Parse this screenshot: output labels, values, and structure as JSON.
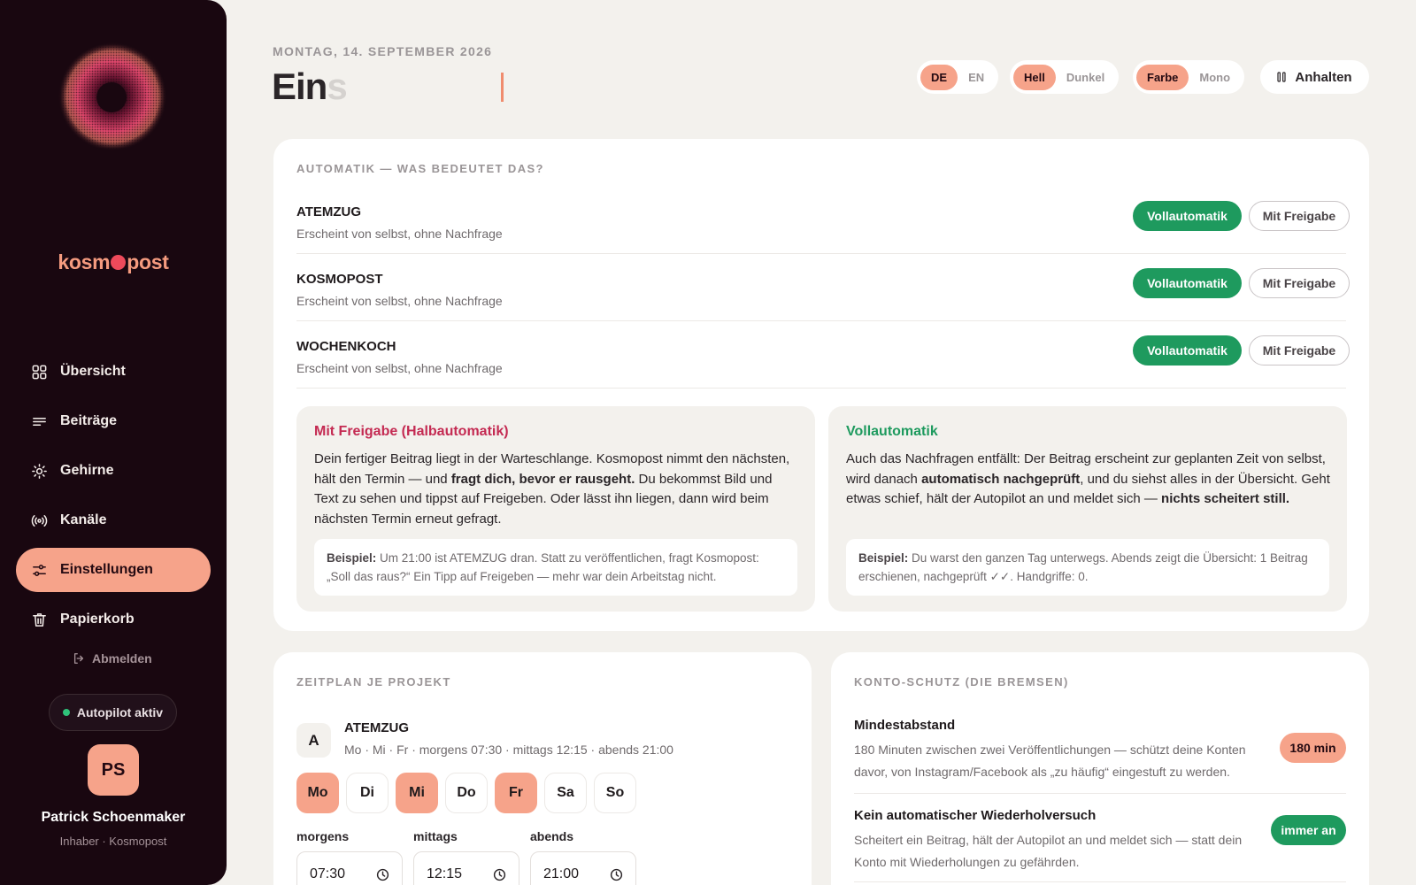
{
  "sidebar": {
    "brand_left": "kosm",
    "brand_right": "post",
    "nav": [
      {
        "label": "Übersicht",
        "icon": "grid-icon"
      },
      {
        "label": "Beiträge",
        "icon": "lines-icon"
      },
      {
        "label": "Gehirne",
        "icon": "sun-icon"
      },
      {
        "label": "Kanäle",
        "icon": "broadcast-icon"
      },
      {
        "label": "Einstellungen",
        "icon": "sliders-icon",
        "active": true
      },
      {
        "label": "Papierkorb",
        "icon": "trash-icon"
      }
    ],
    "logout": "Abmelden",
    "autopilot": "Autopilot aktiv",
    "user": {
      "initials": "PS",
      "name": "Patrick Schoenmaker",
      "role": "Inhaber · Kosmopost"
    }
  },
  "header": {
    "date": "MONTAG, 14. SEPTEMBER 2026",
    "title_typed": "Ein",
    "title_ghost": "s",
    "lang": {
      "options": [
        "DE",
        "EN"
      ],
      "selected": "DE"
    },
    "theme": {
      "options": [
        "Hell",
        "Dunkel"
      ],
      "selected": "Hell"
    },
    "color": {
      "options": [
        "Farbe",
        "Mono"
      ],
      "selected": "Farbe"
    },
    "pause": "Anhalten"
  },
  "automatik": {
    "heading": "AUTOMATIK — WAS BEDEUTET DAS?",
    "rows": [
      {
        "name": "ATEMZUG",
        "desc": "Erscheint von selbst, ohne Nachfrage",
        "btn_full": "Vollautomatik",
        "btn_approval": "Mit Freigabe",
        "mode": "Vollautomatik"
      },
      {
        "name": "KOSMOPOST",
        "desc": "Erscheint von selbst, ohne Nachfrage",
        "btn_full": "Vollautomatik",
        "btn_approval": "Mit Freigabe",
        "mode": "Vollautomatik"
      },
      {
        "name": "WOCHENKOCH",
        "desc": "Erscheint von selbst, ohne Nachfrage",
        "btn_full": "Vollautomatik",
        "btn_approval": "Mit Freigabe",
        "mode": "Vollautomatik"
      }
    ],
    "half": {
      "title": "Mit Freigabe (Halbautomatik)",
      "p1": "Dein fertiger Beitrag liegt in der Warteschlange. Kosmopost nimmt den nächsten, hält den Termin — und ",
      "p_bold": "fragt dich, bevor er rausgeht.",
      "p2": " Du bekommst Bild und Text zu sehen und tippst auf Freigeben. Oder lässt ihn liegen, dann wird beim nächsten Termin erneut gefragt.",
      "ex_label": "Beispiel:",
      "ex_text": " Um 21:00 ist ATEMZUG dran. Statt zu veröffentlichen, fragt Kosmopost: „Soll das raus?“ Ein Tipp auf Freigeben — mehr war dein Arbeitstag nicht."
    },
    "full": {
      "title": "Vollautomatik",
      "p1": "Auch das Nachfragen entfällt: Der Beitrag erscheint zur geplanten Zeit von selbst, wird danach ",
      "p_bold": "automatisch nachgeprüft",
      "p2": ", und du siehst alles in der Übersicht. Geht etwas schief, hält der Autopilot an und meldet sich — ",
      "p_bold2": "nichts scheitert still.",
      "ex_label": "Beispiel:",
      "ex_text": " Du warst den ganzen Tag unterwegs. Abends zeigt die Übersicht: 1 Beitrag erschienen, nachgeprüft ✓✓. Handgriffe: 0."
    }
  },
  "zeitplan": {
    "heading": "ZEITPLAN JE PROJEKT",
    "project": {
      "badge": "A",
      "name": "ATEMZUG",
      "desc": "Mo · Mi · Fr · morgens 07:30 · mittags 12:15 · abends 21:00",
      "days": [
        {
          "label": "Mo",
          "on": true
        },
        {
          "label": "Di",
          "on": false
        },
        {
          "label": "Mi",
          "on": true
        },
        {
          "label": "Do",
          "on": false
        },
        {
          "label": "Fr",
          "on": true
        },
        {
          "label": "Sa",
          "on": false
        },
        {
          "label": "So",
          "on": false
        }
      ],
      "times": [
        {
          "label": "morgens",
          "value": "07:30"
        },
        {
          "label": "mittags",
          "value": "12:15"
        },
        {
          "label": "abends",
          "value": "21:00"
        }
      ]
    }
  },
  "schutz": {
    "heading": "KONTO-SCHUTZ (DIE BREMSEN)",
    "rules": [
      {
        "name": "Mindestabstand",
        "desc": "180 Minuten zwischen zwei Veröffentlichungen — schützt deine Konten davor, von Instagram/Facebook als „zu häufig“ eingestuft zu werden.",
        "value": "180 min"
      },
      {
        "name": "Kein automatischer Wiederholversuch",
        "desc": "Scheitert ein Beitrag, hält der Autopilot an und meldet sich — statt dein Konto mit Wiederholungen zu gefährden.",
        "value": "immer an"
      }
    ]
  },
  "colors": {
    "accent": "#f6a38a",
    "green": "#1e9a5e",
    "crimson": "#c42a52",
    "sidebar": "#190710"
  }
}
